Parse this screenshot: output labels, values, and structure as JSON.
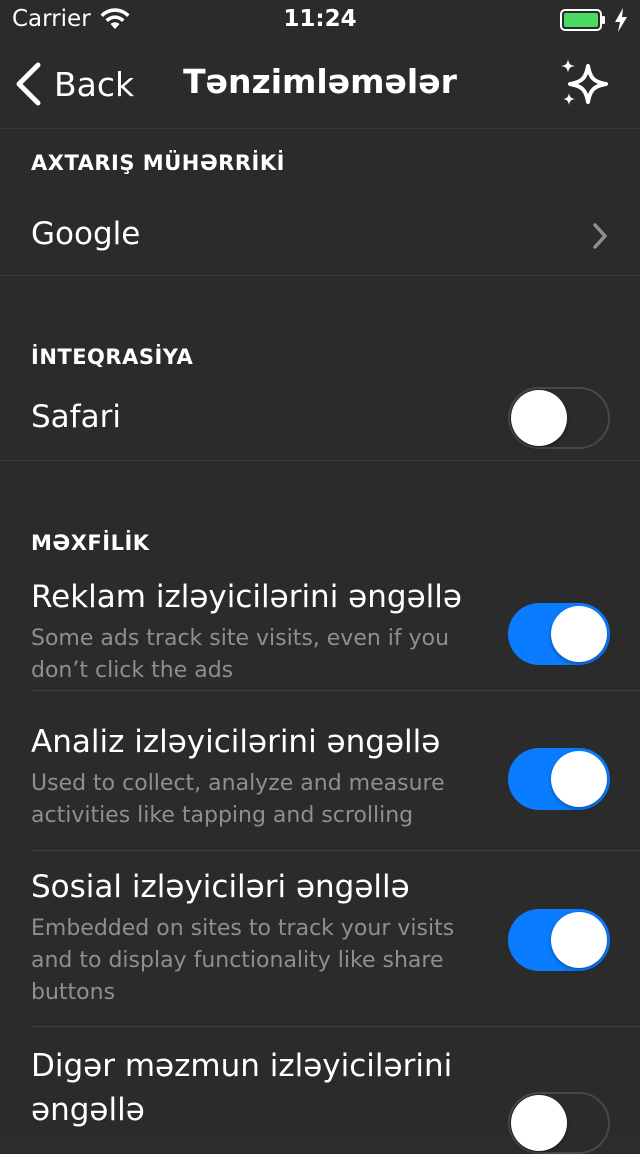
{
  "status_bar": {
    "carrier": "Carrier",
    "time": "11:24",
    "battery_color": "#4cd964"
  },
  "nav": {
    "back_label": "Back",
    "title": "Tənzimləmələr"
  },
  "sections": {
    "search_engine": {
      "header": "AXTARIŞ MÜHƏRRİKİ",
      "value": "Google"
    },
    "integration": {
      "header": "İNTEQRASİYA",
      "safari_label": "Safari",
      "safari_on": false
    },
    "privacy": {
      "header": "MƏXFİLİK",
      "items": [
        {
          "title": "Reklam izləyicilərini əngəllə",
          "subtitle": "Some ads track site visits, even if you don’t click the ads",
          "on": true
        },
        {
          "title": "Analiz izləyicilərini əngəllə",
          "subtitle": "Used to collect, analyze and measure activities like tapping and scrolling",
          "on": true
        },
        {
          "title": "Sosial izləyiciləri əngəllə",
          "subtitle": "Embedded on sites to track your visits and to display functionality like share buttons",
          "on": true
        },
        {
          "title": "Digər məzmun izləyicilərini əngəllə",
          "subtitle": "",
          "on": false
        }
      ]
    }
  },
  "colors": {
    "accent": "#0a7cff",
    "background": "#2b2b2b",
    "secondary_text": "#8e8e93"
  }
}
